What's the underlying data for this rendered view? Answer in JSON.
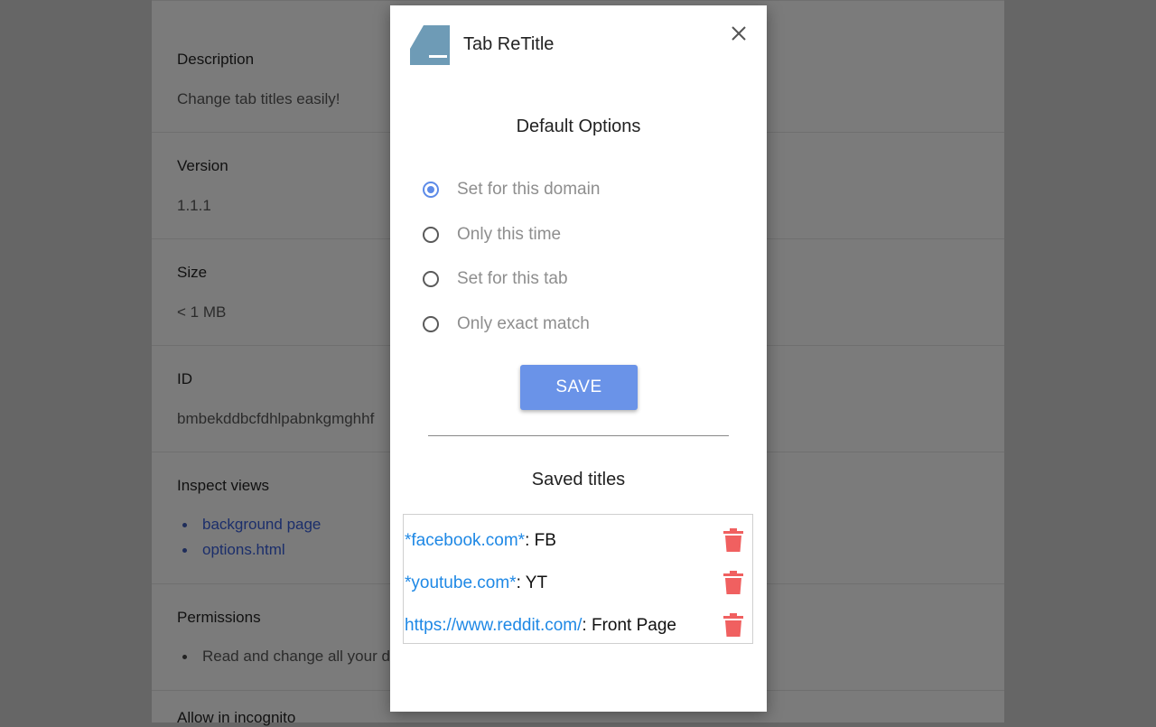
{
  "background_page": {
    "sections": [
      {
        "label": "Description",
        "value": "Change tab titles easily!"
      },
      {
        "label": "Version",
        "value": "1.1.1"
      },
      {
        "label": "Size",
        "value": "< 1 MB"
      },
      {
        "label": "ID",
        "value": "bmbekddbcfdhlpabnkgmghhf"
      },
      {
        "label": "Inspect views",
        "links": [
          "background page",
          "options.html"
        ]
      },
      {
        "label": "Permissions",
        "items": [
          "Read and change all your d"
        ]
      },
      {
        "label": "Allow in incognito"
      }
    ]
  },
  "popup": {
    "app_title": "Tab ReTitle",
    "logo_icon": "tab-retitle-logo",
    "close_icon": "close-icon",
    "default_options": {
      "heading": "Default Options",
      "options": [
        {
          "label": "Set for this domain",
          "checked": true
        },
        {
          "label": "Only this time",
          "checked": false
        },
        {
          "label": "Set for this tab",
          "checked": false
        },
        {
          "label": "Only exact match",
          "checked": false
        }
      ],
      "save_label": "SAVE"
    },
    "saved_titles": {
      "heading": "Saved titles",
      "items": [
        {
          "pattern": "*facebook.com*",
          "separator": ":",
          "title": "FB"
        },
        {
          "pattern": "*youtube.com*",
          "separator": ":",
          "title": "YT"
        },
        {
          "pattern": "https://www.reddit.com/",
          "separator": ":",
          "title": "Front Page"
        }
      ]
    }
  },
  "colors": {
    "accent": "#6a93e8",
    "link": "#1e88e5",
    "delete": "#f06060",
    "logo": "#6e9bb6"
  }
}
